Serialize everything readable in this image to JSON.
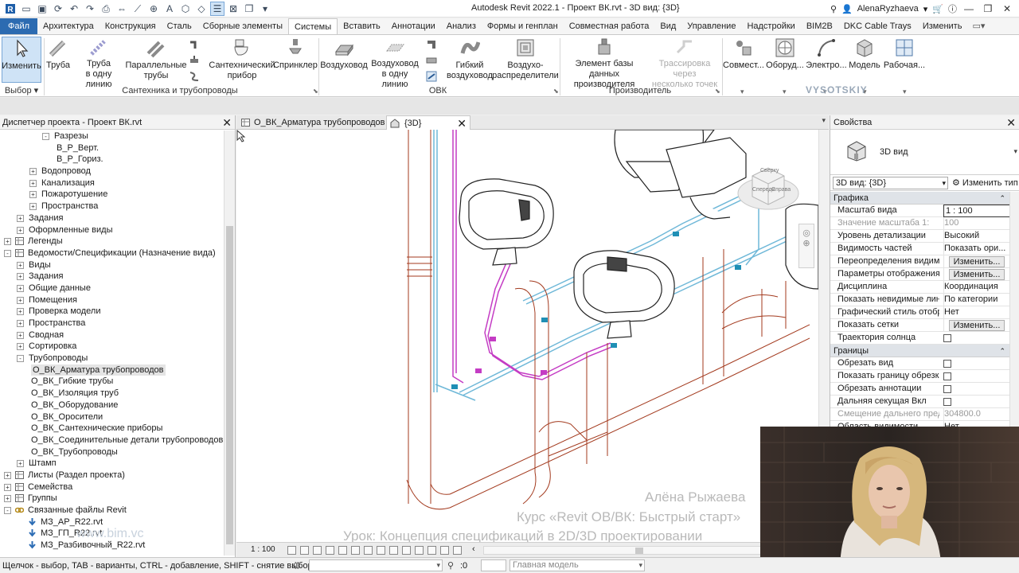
{
  "app": {
    "title": "Autodesk Revit 2022.1 - Проект ВК.rvt - 3D вид: {3D}",
    "user": "AlenaRyzhaeva"
  },
  "ribbon_tabs": [
    "Файл",
    "Архитектура",
    "Конструкция",
    "Сталь",
    "Сборные элементы",
    "Системы",
    "Вставить",
    "Аннотации",
    "Анализ",
    "Формы и генплан",
    "Совместная работа",
    "Вид",
    "Управление",
    "Надстройки",
    "BIM2B",
    "DKC Cable Trays",
    "Изменить"
  ],
  "ribbon": {
    "buttons": {
      "modify": "Изменить",
      "pipe": "Труба",
      "pipe_slope_1": "Труба",
      "pipe_slope_2": "в одну линию",
      "parallel_1": "Параллельные",
      "parallel_2": "трубы",
      "plumbing_1": "Сантехнический",
      "plumbing_2": "прибор",
      "sprinkler": "Спринклер",
      "duct": "Воздуховод",
      "duct_slope_1": "Воздуховод",
      "duct_slope_2": "в одну линию",
      "flex_1": "Гибкий",
      "flex_2": "воздуховод",
      "terminal_1": "Воздухо-",
      "terminal_2": "распределители",
      "fabrication_1": "Элемент базы данных",
      "fabrication_2": "производителя",
      "route_1": "Трассировка через",
      "route_2": "несколько точек",
      "coord": "Совмест...",
      "equipment": "Оборуд...",
      "electric": "Электро...",
      "model": "Модель",
      "workplane": "Рабочая..."
    },
    "panels": {
      "select": "Выбор",
      "plumbing": "Сантехника и трубопроводы",
      "hvac": "ОВК",
      "fabrication": "Производитель"
    },
    "logo": "VYSOTSKIY"
  },
  "browser": {
    "title": "Диспетчер проекта - Проект ВК.rvt",
    "items": [
      {
        "label": "Разрезы",
        "depth": 4,
        "toggle": "-"
      },
      {
        "label": "В_Р_Верт.",
        "depth": 5,
        "toggle": ""
      },
      {
        "label": "В_Р_Гориз.",
        "depth": 5,
        "toggle": ""
      },
      {
        "label": "Водопровод",
        "depth": 3,
        "toggle": "+"
      },
      {
        "label": "Канализация",
        "depth": 3,
        "toggle": "+"
      },
      {
        "label": "Пожаротушение",
        "depth": 3,
        "toggle": "+"
      },
      {
        "label": "Пространства",
        "depth": 3,
        "toggle": "+"
      },
      {
        "label": "Задания",
        "depth": 2,
        "toggle": "+"
      },
      {
        "label": "Оформленные виды",
        "depth": 2,
        "toggle": "+"
      },
      {
        "label": "Легенды",
        "depth": 1,
        "toggle": "+",
        "icon": "grid-icon"
      },
      {
        "label": "Ведомости/Спецификации (Назначение вида)",
        "depth": 1,
        "toggle": "-",
        "icon": "table-icon"
      },
      {
        "label": "Виды",
        "depth": 2,
        "toggle": "+"
      },
      {
        "label": "Задания",
        "depth": 2,
        "toggle": "+"
      },
      {
        "label": "Общие данные",
        "depth": 2,
        "toggle": "+"
      },
      {
        "label": "Помещения",
        "depth": 2,
        "toggle": "+"
      },
      {
        "label": "Проверка модели",
        "depth": 2,
        "toggle": "+"
      },
      {
        "label": "Пространства",
        "depth": 2,
        "toggle": "+"
      },
      {
        "label": "Сводная",
        "depth": 2,
        "toggle": "+"
      },
      {
        "label": "Сортировка",
        "depth": 2,
        "toggle": "+"
      },
      {
        "label": "Трубопроводы",
        "depth": 2,
        "toggle": "-"
      },
      {
        "label": "О_ВК_Арматура трубопроводов",
        "depth": 3,
        "toggle": "",
        "selected": true
      },
      {
        "label": "О_ВК_Гибкие трубы",
        "depth": 3,
        "toggle": ""
      },
      {
        "label": "О_ВК_Изоляция труб",
        "depth": 3,
        "toggle": ""
      },
      {
        "label": "О_ВК_Оборудование",
        "depth": 3,
        "toggle": ""
      },
      {
        "label": "О_ВК_Оросители",
        "depth": 3,
        "toggle": ""
      },
      {
        "label": "О_ВК_Сантехнические приборы",
        "depth": 3,
        "toggle": ""
      },
      {
        "label": "О_ВК_Соединительные детали трубопроводов",
        "depth": 3,
        "toggle": ""
      },
      {
        "label": "О_ВК_Трубопроводы",
        "depth": 3,
        "toggle": ""
      },
      {
        "label": "Штамп",
        "depth": 2,
        "toggle": "+"
      },
      {
        "label": "Листы (Раздел проекта)",
        "depth": 1,
        "toggle": "+",
        "icon": "sheet-icon"
      },
      {
        "label": "Семейства",
        "depth": 1,
        "toggle": "+",
        "icon": "family-icon"
      },
      {
        "label": "Группы",
        "depth": 1,
        "toggle": "+",
        "icon": "group-icon"
      },
      {
        "label": "Связанные файлы Revit",
        "depth": 1,
        "toggle": "-",
        "icon": "link-icon"
      },
      {
        "label": "МЗ_АР_R22.rvt",
        "depth": 2,
        "toggle": "",
        "icon": "arrow-down-icon"
      },
      {
        "label": "МЗ_ГП_R22.rvt",
        "depth": 2,
        "toggle": "",
        "icon": "arrow-down-icon"
      },
      {
        "label": "МЗ_Разбивочный_R22.rvt",
        "depth": 2,
        "toggle": "",
        "icon": "arrow-down-icon"
      }
    ],
    "watermark": "www.bim.vc"
  },
  "view_tabs": [
    {
      "label": "О_ВК_Арматура трубопроводов",
      "active": false
    },
    {
      "label": "{3D}",
      "active": true
    }
  ],
  "canvas": {
    "viewcube_front": "Спереди",
    "viewcube_right": "Справа",
    "viewcube_top": "Сверху"
  },
  "overlay": {
    "author": "Алёна Рыжаева",
    "course": "Курс «Revit ОВ/ВК: Быстрый старт»",
    "lesson": "Урок: Концепция спецификаций в 2D/3D проектировании"
  },
  "viewbar": {
    "scale": "1 : 100"
  },
  "properties": {
    "title": "Свойства",
    "type_name": "3D вид",
    "instance_selector": "3D вид: {3D}",
    "edit_type": "Изменить тип",
    "groups": [
      {
        "name": "Графика",
        "rows": [
          {
            "name": "Масштаб вида",
            "value": "1 : 100",
            "kind": "input"
          },
          {
            "name": "Значение масштаба    1:",
            "value": "100",
            "kind": "dim"
          },
          {
            "name": "Уровень детализации",
            "value": "Высокий",
            "kind": "text"
          },
          {
            "name": "Видимость частей",
            "value": "Показать ори...",
            "kind": "text"
          },
          {
            "name": "Переопределения видим...",
            "value": "Изменить...",
            "kind": "button"
          },
          {
            "name": "Параметры отображения ...",
            "value": "Изменить...",
            "kind": "button"
          },
          {
            "name": "Дисциплина",
            "value": "Координация",
            "kind": "text"
          },
          {
            "name": "Показать невидимые лин...",
            "value": "По категории",
            "kind": "text"
          },
          {
            "name": "Графический стиль отобр...",
            "value": "Нет",
            "kind": "text"
          },
          {
            "name": "Показать сетки",
            "value": "Изменить...",
            "kind": "button"
          },
          {
            "name": "Траектория солнца",
            "value": "",
            "kind": "check"
          }
        ]
      },
      {
        "name": "Границы",
        "rows": [
          {
            "name": "Обрезать вид",
            "value": "",
            "kind": "check"
          },
          {
            "name": "Показать границу обрезки",
            "value": "",
            "kind": "check"
          },
          {
            "name": "Обрезать аннотации",
            "value": "",
            "kind": "check"
          },
          {
            "name": "Дальняя секущая Вкл",
            "value": "",
            "kind": "check"
          },
          {
            "name": "Смещение дальнего пред...",
            "value": "304800.0",
            "kind": "dim"
          },
          {
            "name": "Область видимости",
            "value": "Нет",
            "kind": "text"
          }
        ]
      }
    ]
  },
  "status": {
    "hint": "Щелчок - выбор, TAB - варианты, CTRL - добавление, SHIFT - снятие выбора.",
    "count": ":0",
    "model": "Главная модель"
  },
  "colors": {
    "file_tab": "#2c6bb1",
    "sewer_pipe": "#a33a1e",
    "cold_water": "#6fb8d8",
    "hot_water": "#c43cc4",
    "selection": "#cfe3f6"
  }
}
